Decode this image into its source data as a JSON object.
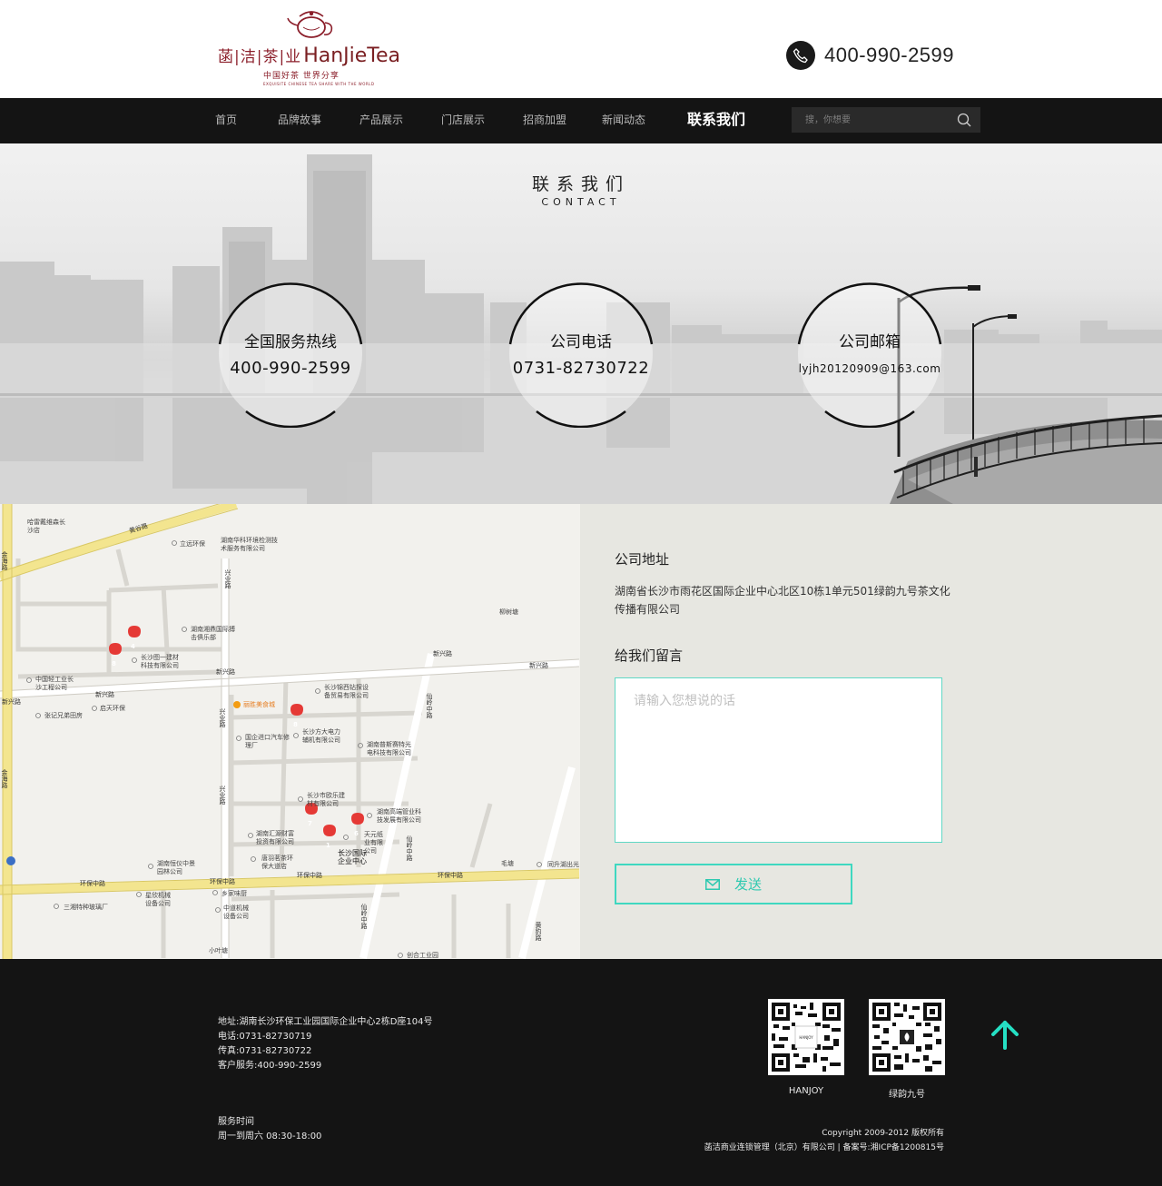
{
  "header": {
    "logo_cn": "菡|洁|茶|业",
    "logo_en": "HanJieTea",
    "logo_slogan": "中国好茶  世界分享",
    "logo_slogan_en": "EXQUISITE CHINESE TEA     SHARE WITH THE WORLD",
    "phone": "400-990-2599"
  },
  "nav": {
    "items": [
      {
        "label": "首页"
      },
      {
        "label": "品牌故事"
      },
      {
        "label": "产品展示"
      },
      {
        "label": "门店展示"
      },
      {
        "label": "招商加盟"
      },
      {
        "label": "新闻动态"
      },
      {
        "label": "联系我们"
      }
    ],
    "search_placeholder": "搜，你想要"
  },
  "hero": {
    "title": "联系我们",
    "subtitle": "CONTACT",
    "circles": [
      {
        "label": "全国服务热线",
        "value": "400-990-2599"
      },
      {
        "label": "公司电话",
        "value": "0731-82730722"
      },
      {
        "label": "公司邮箱",
        "value": "lyjh20120909@163.com"
      }
    ]
  },
  "map": {
    "roads": [
      "黄谷路",
      "兴业路",
      "兴业路",
      "兴业路",
      "新兴路",
      "新兴路",
      "新兴路",
      "新兴路",
      "新兴路",
      "环保中路",
      "环保中路",
      "环保中路",
      "环保中路",
      "仙岭中路",
      "仙岭中路",
      "仙岭中路",
      "金海路",
      "金海路",
      "黄豹路"
    ],
    "pois": [
      "哈雷戴维森长沙店",
      "立远环保",
      "湖南华科环境检测技术服务有限公司",
      "湖南湘鼎国际搏击俱乐部",
      "长沙图一建材科技有限公司",
      "柳树塘",
      "中国轻工业长沙工程公司",
      "长沙锦西钻探设备贸易有限公司",
      "启天环保",
      "张记兄弟田房",
      "丽胜美食城",
      "国企进口汽车修理厂",
      "长沙方大电力辅机有限公司",
      "湖南普斯赛特光电科技有限公司",
      "长沙市欧乐建材有限公司",
      "湖南高端管业科技发展有限公司",
      "湖南汇源财富投资有限公司",
      "天元纸业有限公司",
      "唐羽茗茶环保大道店",
      "长沙国际企业中心",
      "湖南恒仪中景园林公司",
      "毛塘",
      "同升湖出光",
      "乡家味厨",
      "三湘特种玻璃厂",
      "星欣机械设备公司",
      "中道机械设备公司",
      "小叶塘",
      "创合工业园"
    ],
    "markers": [
      "4",
      "8",
      "8",
      "7",
      "6",
      "1"
    ]
  },
  "contact": {
    "address_title": "公司地址",
    "address": "湖南省长沙市雨花区国际企业中心北区10栋1单元501绿韵九号茶文化传播有限公司",
    "message_title": "给我们留言",
    "message_placeholder": "请输入您想说的话",
    "send_label": "发送"
  },
  "footer": {
    "address": "地址:湖南长沙环保工业园国际企业中心2栋D座104号",
    "tel": "电话:0731-82730719",
    "fax": "传真:0731-82730722",
    "service": "客户服务:400-990-2599",
    "hours_title": "服务时间",
    "hours": "周一到周六 08:30-18:00",
    "qr1_caption": "HANJOY",
    "qr2_caption": "绿韵九号",
    "copyright": "Copyright  2009-2012 版权所有",
    "company": "菡洁商业连锁管理（北京）有限公司 | 备案号:湘ICP备1200815号"
  },
  "colors": {
    "nav_bg": "#141414",
    "accent": "#3fd8c0",
    "logo": "#8b1e2a",
    "map_pin": "#e53935"
  }
}
